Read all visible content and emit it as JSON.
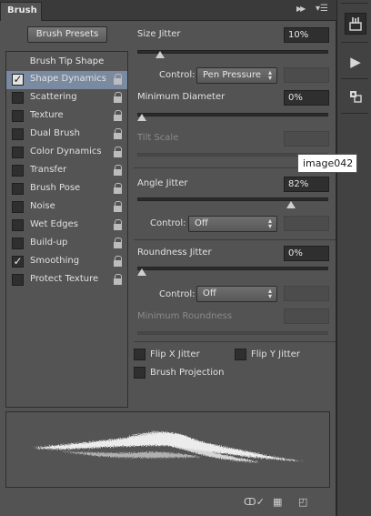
{
  "panel": {
    "tab_label": "Brush",
    "presets_button": "Brush Presets",
    "tip_shape_label": "Brush Tip Shape"
  },
  "options_list": [
    {
      "label": "Shape Dynamics",
      "checked": true,
      "selected": true
    },
    {
      "label": "Scattering",
      "checked": false,
      "selected": false
    },
    {
      "label": "Texture",
      "checked": false,
      "selected": false
    },
    {
      "label": "Dual Brush",
      "checked": false,
      "selected": false
    },
    {
      "label": "Color Dynamics",
      "checked": false,
      "selected": false
    },
    {
      "label": "Transfer",
      "checked": false,
      "selected": false
    },
    {
      "label": "Brush Pose",
      "checked": false,
      "selected": false
    },
    {
      "label": "Noise",
      "checked": false,
      "selected": false
    },
    {
      "label": "Wet Edges",
      "checked": false,
      "selected": false
    },
    {
      "label": "Build-up",
      "checked": false,
      "selected": false
    },
    {
      "label": "Smoothing",
      "checked": true,
      "selected": false
    },
    {
      "label": "Protect Texture",
      "checked": false,
      "selected": false
    }
  ],
  "size_jitter": {
    "label": "Size Jitter",
    "value": "10%",
    "slider_fraction": 0.1
  },
  "size_control": {
    "label": "Control:",
    "value": "Pen Pressure"
  },
  "minimum_diameter": {
    "label": "Minimum Diameter",
    "value": "0%",
    "slider_fraction": 0.0
  },
  "tilt_scale": {
    "label": "Tilt Scale"
  },
  "tooltip": {
    "text": "image042"
  },
  "angle_jitter": {
    "label": "Angle Jitter",
    "value": "82%",
    "slider_fraction": 0.82
  },
  "angle_control": {
    "label": "Control:",
    "value": "Off"
  },
  "roundness_jitter": {
    "label": "Roundness Jitter",
    "value": "0%",
    "slider_fraction": 0.0
  },
  "roundness_control": {
    "label": "Control:",
    "value": "Off"
  },
  "minimum_roundness": {
    "label": "Minimum Roundness"
  },
  "flip_x": {
    "label": "Flip X Jitter",
    "checked": false
  },
  "flip_y": {
    "label": "Flip Y Jitter",
    "checked": false
  },
  "brush_projection": {
    "label": "Brush Projection",
    "checked": false
  },
  "icons": {
    "collapse": "double-chevron-right-icon",
    "menu": "panel-menu-icon",
    "brush_toggle": "brush-panel-icon",
    "play": "play-icon",
    "clone_source": "clone-source-icon"
  }
}
